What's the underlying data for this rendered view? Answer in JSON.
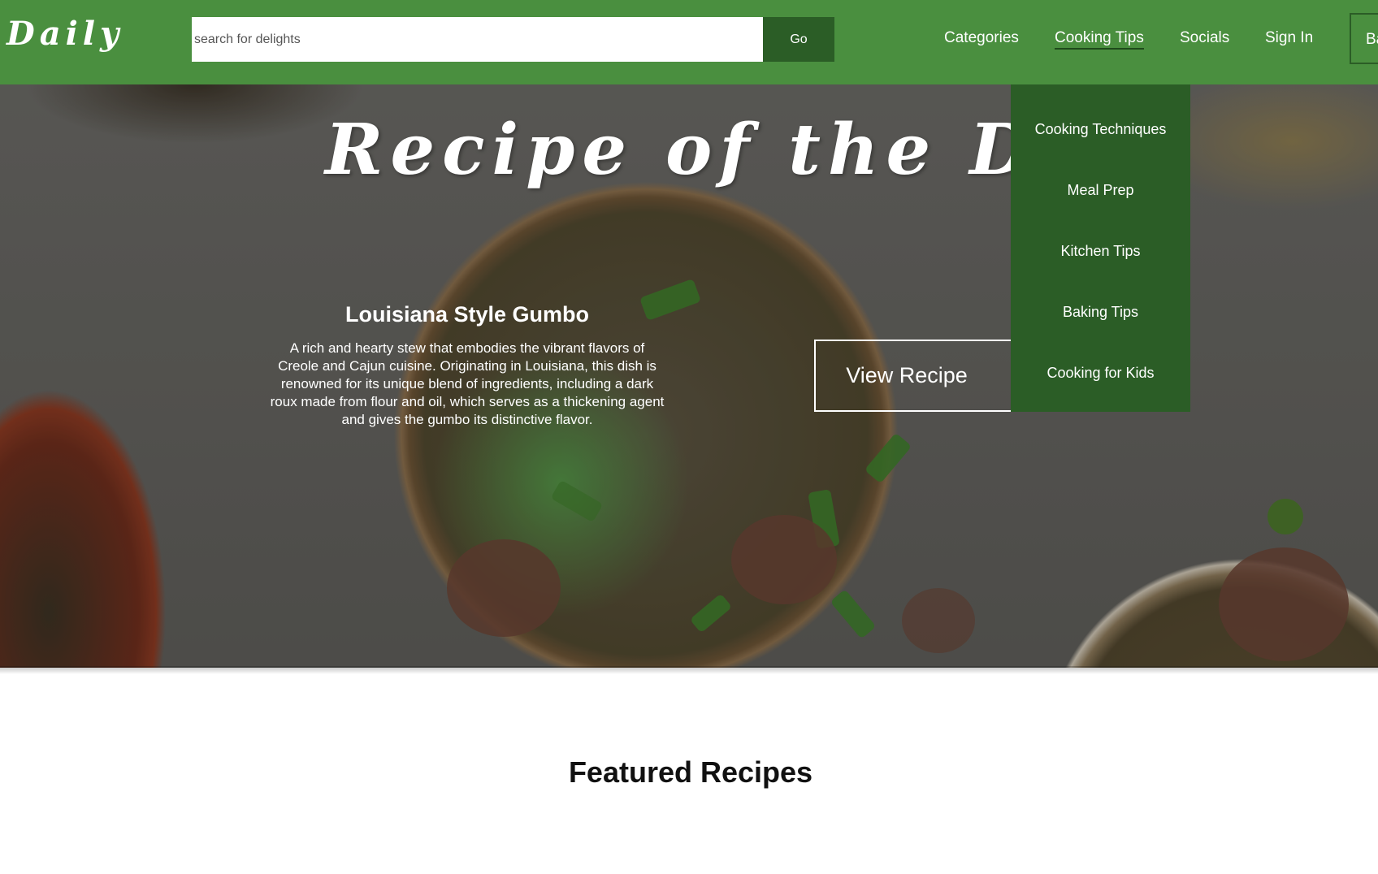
{
  "header": {
    "logo": "Daily",
    "search": {
      "placeholder": "search for delights",
      "value": ""
    },
    "go_label": "Go",
    "nav": [
      {
        "label": "Categories",
        "active": false
      },
      {
        "label": "Cooking Tips",
        "active": true
      },
      {
        "label": "Socials",
        "active": false
      },
      {
        "label": "Sign In",
        "active": false
      }
    ],
    "cut_button_label": "Ba"
  },
  "dropdown": {
    "items": [
      "Cooking Techniques",
      "Meal Prep",
      "Kitchen Tips",
      "Baking Tips",
      "Cooking for Kids"
    ]
  },
  "hero": {
    "title": "Recipe of the Day",
    "recipe_name": "Louisiana Style Gumbo",
    "description": "A rich and hearty stew that embodies the vibrant flavors of Creole and Cajun cuisine. Originating in Louisiana, this dish is renowned for its unique blend of ingredients, including a dark roux made from flour and oil, which serves as a thickening agent and gives the gumbo its distinctive flavor.",
    "view_button": "View Recipe",
    "image": "gumbo-bowls-photo"
  },
  "featured": {
    "title": "Featured Recipes"
  },
  "colors": {
    "header_green": "#4a8f3f",
    "dark_green": "#2b5d26",
    "text_white": "#ffffff"
  }
}
